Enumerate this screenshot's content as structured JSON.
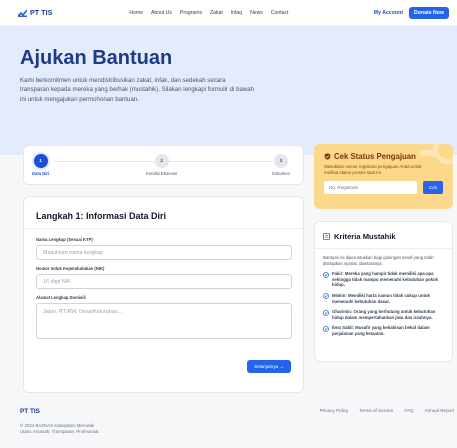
{
  "brand": {
    "name": "PT TIS"
  },
  "nav": {
    "items": [
      "Home",
      "About Us",
      "Programs",
      "Zakat",
      "Infaq",
      "News",
      "Contact"
    ],
    "account": "My Account",
    "donate": "Donate Now"
  },
  "hero": {
    "title": "Ajukan Bantuan",
    "description": "Kami berkomitmen untuk mendistribusikan zakat, infak, dan sedekah secara transparan kepada mereka yang berhak (mustahik). Silakan lengkapi formulir di bawah ini untuk mengajukan permohonan bantuan."
  },
  "stepper": {
    "steps": [
      {
        "number": "1",
        "label": "Data Diri"
      },
      {
        "number": "2",
        "label": "Kondisi Ekonomi"
      },
      {
        "number": "3",
        "label": "Dokumen"
      }
    ],
    "active_index": 0
  },
  "form": {
    "title": "Langkah 1: Informasi Data Diri",
    "fields": [
      {
        "label": "Nama Lengkap (Sesuai KTP)",
        "placeholder": "Masukkan nama lengkap"
      },
      {
        "label": "Nomor Induk Kependudukan (NIK)",
        "placeholder": "16 digit NIK"
      },
      {
        "label": "Alamat Lengkap Domisili",
        "placeholder": "Jalan, RT/RW, Desa/Kelurahan..."
      }
    ],
    "next_label": "Selanjutnya →"
  },
  "status": {
    "title": "Cek Status Pengajuan",
    "description": "Masukkan nomor registrasi pengajuan Anda untuk melihat status proses saat ini.",
    "placeholder": "No. Registrasi",
    "button": "Cek"
  },
  "criteria": {
    "title": "Kriteria Mustahik",
    "intro": "Bantuan ini diperuntukkan bagi golongan asnaf yang telah ditetapkan syariat, diantaranya:",
    "items": [
      "Fakir: Mereka yang hampir tidak memiliki apa-apa sehingga tidak mampu memenuhi kebutuhan pokok hidup.",
      "Miskin: Memiliki harta namun tidak cukup untuk memenuhi kebutuhan dasar.",
      "Gharimin: Orang yang berhutang untuk kebutuhan hidup dalam mempertahankan jiwa dan izzahnya.",
      "Ibnu Sabil: Musafir yang kehabisan bekal dalam perjalanan yang ketaatan."
    ]
  },
  "footer": {
    "brand": "PT TIS",
    "copyright_line1": "© 2024 BAZNAS Kabupaten Merowali",
    "copyright_line2": "Utara. Amanah, Transparan, Profesional.",
    "links": [
      "Privacy Policy",
      "Terms of Service",
      "FAQ",
      "Annual Report"
    ]
  },
  "colors": {
    "primary": "#2563eb",
    "navy": "#1e3a8a",
    "hero_bg": "#e4ecfb",
    "status_bg": "#fcd88a"
  }
}
